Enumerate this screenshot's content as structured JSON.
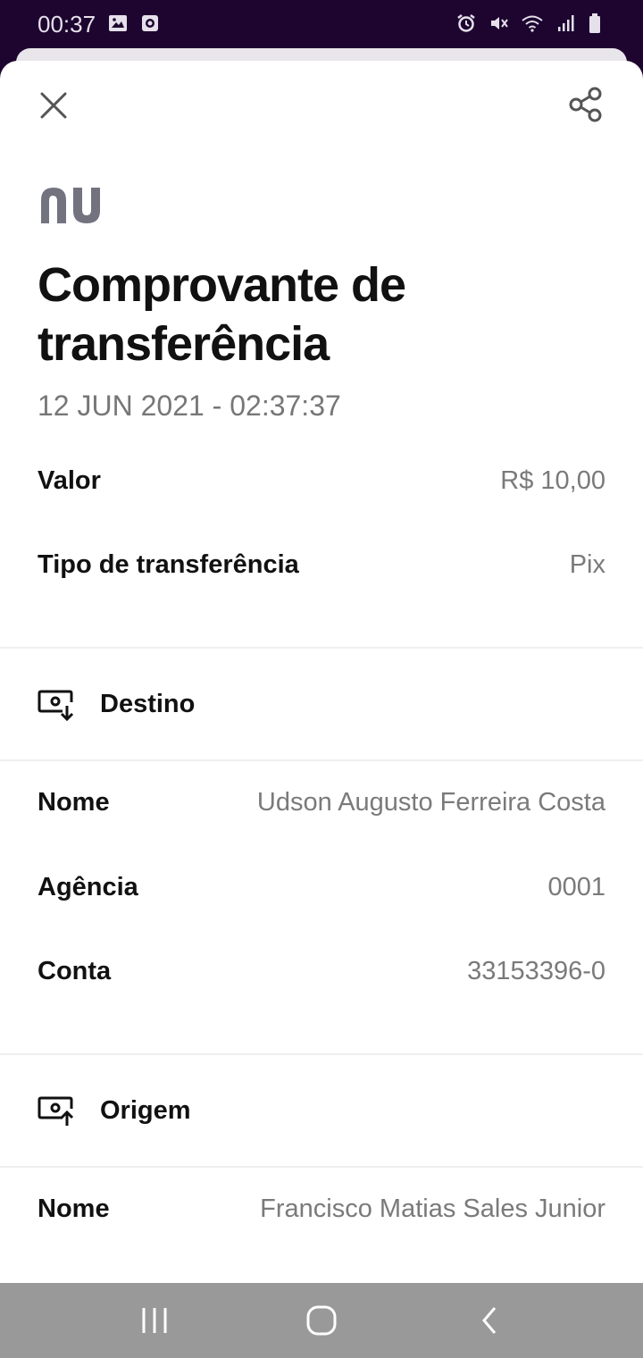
{
  "status_bar": {
    "time": "00:37",
    "left_icons": [
      "image-icon",
      "screen-record-icon"
    ],
    "right_icons": [
      "alarm-icon",
      "mute-icon",
      "wifi-icon",
      "signal-icon",
      "battery-icon"
    ]
  },
  "header": {
    "close_icon": "close-icon",
    "share_icon": "share-icon",
    "logo_text": "nu"
  },
  "receipt": {
    "title": "Comprovante de transferência",
    "datetime": "12 JUN 2021 - 02:37:37",
    "valor_label": "Valor",
    "valor_value": "R$ 10,00",
    "tipo_label": "Tipo de transferência",
    "tipo_value": "Pix"
  },
  "destino": {
    "section_label": "Destino",
    "nome_label": "Nome",
    "nome_value": "Udson Augusto Ferreira Costa",
    "agencia_label": "Agência",
    "agencia_value": "0001",
    "conta_label": "Conta",
    "conta_value": "33153396-0"
  },
  "origem": {
    "section_label": "Origem",
    "nome_label": "Nome",
    "nome_value": "Francisco Matias Sales Junior"
  },
  "nav_bar": {
    "buttons": [
      "recents-icon",
      "home-icon",
      "back-icon"
    ]
  },
  "colors": {
    "status_bar_bg": "#1d0530",
    "logo": "#737380",
    "nav_bar_bg": "#999999"
  }
}
